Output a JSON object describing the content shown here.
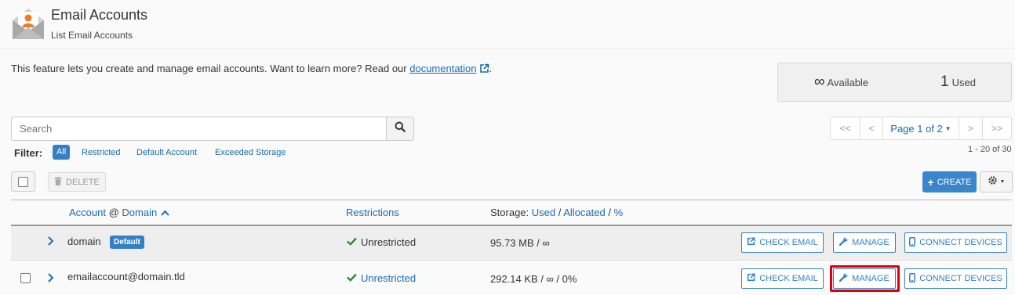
{
  "header": {
    "title": "Email Accounts",
    "subtitle": "List Email Accounts",
    "icon": "email-accounts-icon"
  },
  "intro": {
    "text": "This feature lets you create and manage email accounts. Want to learn more? Read our ",
    "link": "documentation",
    "suffix": "."
  },
  "stats": {
    "available_value": "∞",
    "available_label": "Available",
    "used_value": "1",
    "used_label": "Used"
  },
  "search": {
    "placeholder": "Search"
  },
  "filter": {
    "label": "Filter:",
    "options": [
      "All",
      "Restricted",
      "Default Account",
      "Exceeded Storage"
    ],
    "selected": "All"
  },
  "pagination": {
    "first": "<<",
    "prev": "<",
    "page_label": "Page 1 of 2",
    "next": ">",
    "last": ">>",
    "count_text": "1 - 20 of 30"
  },
  "toolbar": {
    "delete_label": "DELETE",
    "create_label": "CREATE"
  },
  "table": {
    "col_account": "Account",
    "col_at": " @ ",
    "col_domain": "Domain",
    "col_restrictions": "Restrictions",
    "storage_prefix": "Storage: ",
    "storage_used": "Used",
    "storage_sep1": " / ",
    "storage_allocated": "Allocated",
    "storage_sep2": " / ",
    "storage_percent": "%",
    "rows": [
      {
        "account": "domain",
        "badge": "Default",
        "restriction": "Unrestricted",
        "storage": "95.73 MB / ∞",
        "actions": [
          "CHECK EMAIL",
          "MANAGE",
          "CONNECT DEVICES"
        ]
      },
      {
        "account": "emailaccount@domain.tld",
        "restriction": "Unrestricted",
        "storage": "292.14 KB / ∞ / 0%",
        "actions": [
          "CHECK EMAIL",
          "MANAGE",
          "CONNECT DEVICES"
        ]
      }
    ]
  },
  "colors": {
    "accent": "#3580c5",
    "link": "#1a6cb3",
    "success": "#2e8b2e",
    "highlight": "#d9000d"
  }
}
